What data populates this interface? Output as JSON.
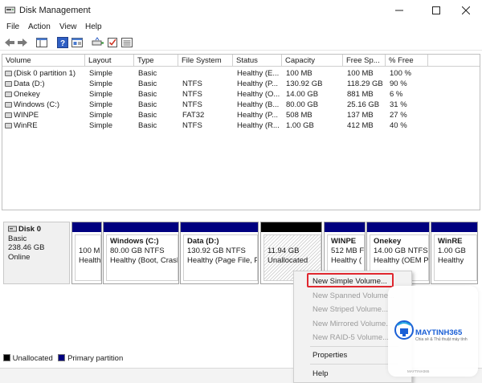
{
  "window": {
    "title": "Disk Management"
  },
  "menu": [
    "File",
    "Action",
    "View",
    "Help"
  ],
  "toolbar_icons": [
    "back-arrow-icon",
    "forward-arrow-icon",
    "console-tree-icon",
    "help-icon",
    "properties-icon",
    "connect-icon",
    "checkmark-icon",
    "list-view-icon"
  ],
  "volume_list": {
    "columns": [
      "Volume",
      "Layout",
      "Type",
      "File System",
      "Status",
      "Capacity",
      "Free Sp...",
      "% Free"
    ],
    "rows": [
      [
        "(Disk 0 partition 1)",
        "Simple",
        "Basic",
        "",
        "Healthy (E...",
        "100 MB",
        "100 MB",
        "100 %"
      ],
      [
        "Data (D:)",
        "Simple",
        "Basic",
        "NTFS",
        "Healthy (P...",
        "130.92 GB",
        "118.29 GB",
        "90 %"
      ],
      [
        "Onekey",
        "Simple",
        "Basic",
        "NTFS",
        "Healthy (O...",
        "14.00 GB",
        "881 MB",
        "6 %"
      ],
      [
        "Windows (C:)",
        "Simple",
        "Basic",
        "NTFS",
        "Healthy (B...",
        "80.00 GB",
        "25.16 GB",
        "31 %"
      ],
      [
        "WINPE",
        "Simple",
        "Basic",
        "FAT32",
        "Healthy (P...",
        "508 MB",
        "137 MB",
        "27 %"
      ],
      [
        "WinRE",
        "Simple",
        "Basic",
        "NTFS",
        "Healthy (R...",
        "1.00 GB",
        "412 MB",
        "40 %"
      ]
    ]
  },
  "disk": {
    "name": "Disk 0",
    "type": "Basic",
    "size": "238.46 GB",
    "status": "Online"
  },
  "partitions": [
    {
      "name": "",
      "size": "100 M",
      "status": "Health",
      "bar": "blue"
    },
    {
      "name": "Windows  (C:)",
      "size": "80.00 GB NTFS",
      "status": "Healthy (Boot, Crasl",
      "bar": "blue"
    },
    {
      "name": "Data  (D:)",
      "size": "130.92 GB NTFS",
      "status": "Healthy (Page File, P",
      "bar": "blue"
    },
    {
      "name": "",
      "size": "11.94 GB",
      "status": "Unallocated",
      "bar": "black"
    },
    {
      "name": "WINPE",
      "size": "512 MB F",
      "status": "Healthy (",
      "bar": "blue"
    },
    {
      "name": "Onekey",
      "size": "14.00 GB NTFS",
      "status": "Healthy (OEM P",
      "bar": "blue"
    },
    {
      "name": "WinRE",
      "size": "1.00 GB",
      "status": "Healthy",
      "bar": "blue"
    }
  ],
  "legend": {
    "unallocated": "Unallocated",
    "primary": "Primary partition"
  },
  "context_menu": {
    "items": [
      {
        "label": "New Simple Volume...",
        "enabled": true
      },
      {
        "label": "New Spanned Volume...",
        "enabled": false
      },
      {
        "label": "New Striped Volume...",
        "enabled": false
      },
      {
        "label": "New Mirrored Volume...",
        "enabled": false
      },
      {
        "label": "New RAID-5 Volume...",
        "enabled": false
      },
      {
        "label": "Properties",
        "enabled": true
      },
      {
        "label": "Help",
        "enabled": true
      }
    ]
  },
  "watermark": {
    "brand": "MAYTINH365",
    "tagline": "Chia sẻ & Thủ thuật máy tính"
  },
  "colors": {
    "primary_partition": "#00007f",
    "unallocated": "#000000",
    "highlight": "#e0272f",
    "brand": "#1a5fd6"
  }
}
